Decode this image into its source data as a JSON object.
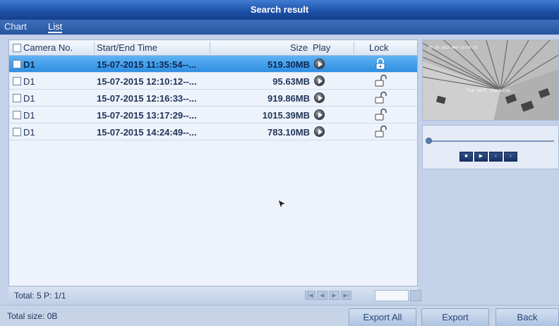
{
  "window": {
    "title": "Search result"
  },
  "tabs": [
    {
      "label": "Chart"
    },
    {
      "label": "List"
    }
  ],
  "table": {
    "headers": {
      "camera": "Camera No.",
      "time": "Start/End Time",
      "size": "Size",
      "play": "Play",
      "lock": "Lock"
    },
    "rows": [
      {
        "camera": "D1",
        "time": "15-07-2015 11:35:54--...",
        "size": "519.30MB",
        "locked": true,
        "selected": true
      },
      {
        "camera": "D1",
        "time": "15-07-2015 12:10:12--...",
        "size": "95.63MB",
        "locked": false,
        "selected": false
      },
      {
        "camera": "D1",
        "time": "15-07-2015 12:16:33--...",
        "size": "919.86MB",
        "locked": false,
        "selected": false
      },
      {
        "camera": "D1",
        "time": "15-07-2015 13:17:29--...",
        "size": "1015.39MB",
        "locked": false,
        "selected": false
      },
      {
        "camera": "D1",
        "time": "15-07-2015 14:24:49--...",
        "size": "783.10MB",
        "locked": false,
        "selected": false
      }
    ]
  },
  "pagination": {
    "summary": "Total: 5  P: 1/1",
    "page_input": ""
  },
  "footer": {
    "total_size": "Total size: 0B"
  },
  "buttons": {
    "export_all": "Export All",
    "export": "Export",
    "back": "Back"
  },
  "preview": {
    "osd": "05-25-2015 Wed 15:55:55",
    "message": "Tip self checking..."
  },
  "playback": {
    "position": 0
  },
  "colors": {
    "title_bar": "#1c4fa6",
    "selected_row": "#2f8fe3",
    "accent": "#3f7cd3"
  },
  "icons": {
    "play": "play-circle-icon",
    "locked": "lock-closed-icon",
    "unlocked": "lock-open-icon"
  }
}
